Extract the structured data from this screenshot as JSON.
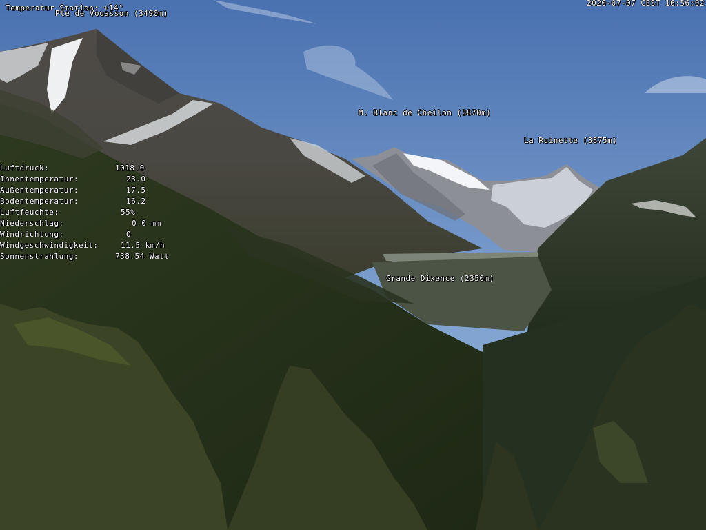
{
  "overlay": {
    "station_temp": "Temperatur Station: +14°",
    "timestamp": "2020-07-07 CEST 16:56:02",
    "peaks": {
      "vouasson": "Pte de Vouasson (3490m)",
      "cheilon": "M. Blanc de Cheilon (3870m)",
      "ruinette": "La Ruinette (3875m)",
      "dixence": "Grande Dixence (2350m)"
    }
  },
  "weather": [
    {
      "label": "Luftdruck:",
      "value": "1018.0"
    },
    {
      "label": "Innentemperatur:",
      "value": "23.0"
    },
    {
      "label": "Außentemperatur:",
      "value": "17.5"
    },
    {
      "label": "Bodentemperatur:",
      "value": "16.2"
    },
    {
      "label": "Luftfeuchte:",
      "value": "55%"
    },
    {
      "label": "Niederschlag:",
      "value": "0.0 mm"
    },
    {
      "label": "Windrichtung:",
      "value": "O"
    },
    {
      "label": "Windgeschwindigkeit:",
      "value": "11.5 km/h"
    },
    {
      "label": "Sonnenstrahlung:",
      "value": "738.54 Watt"
    }
  ],
  "colors": {
    "sky_top": "#4d74b3",
    "sky_bottom": "#8fb0d6",
    "rock": "#5a5650",
    "forest_dark": "#1e2a16",
    "forest_mid": "#34401f",
    "snow": "#f2f4f7",
    "tree": "#3a4224"
  }
}
